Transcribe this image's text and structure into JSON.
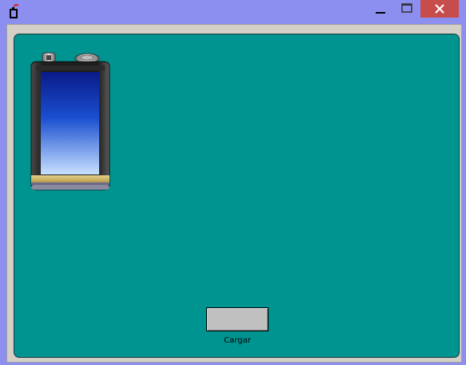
{
  "window": {
    "title": "",
    "icons": {
      "app": "battery-app-icon",
      "minimize": "minimize-icon",
      "maximize": "maximize-icon",
      "close": "close-icon"
    },
    "colors": {
      "titlebar": "#8c8ff0",
      "close_button": "#c74d4d",
      "panel": "#009491"
    }
  },
  "main": {
    "battery": {
      "icon": "battery-9v-icon",
      "level_fraction": 0.83
    },
    "charge_button": {
      "label": ""
    },
    "charge_caption": "Cargar"
  }
}
